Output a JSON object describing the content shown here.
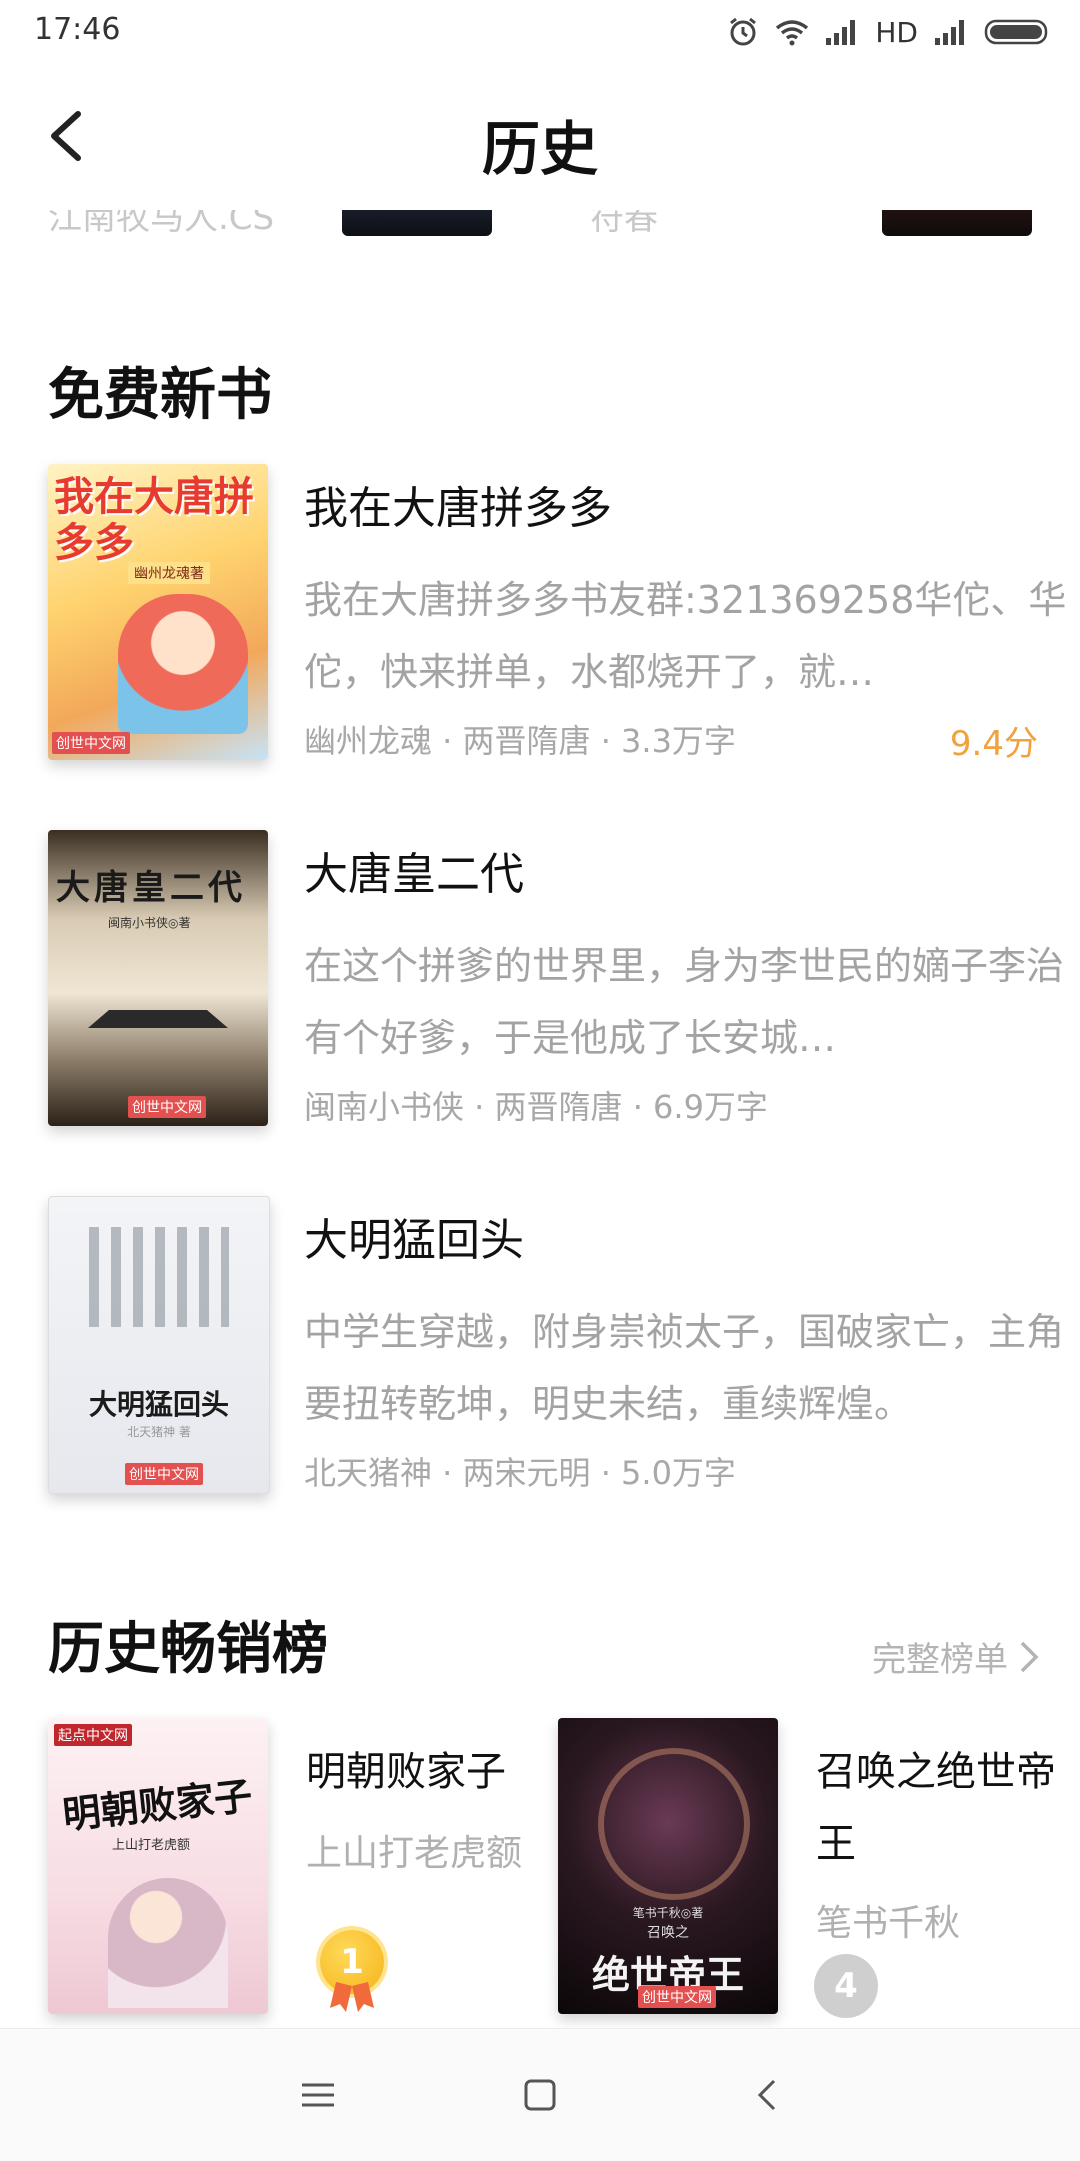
{
  "status_bar": {
    "time": "17:46",
    "network": "HD"
  },
  "header": {
    "title": "历史"
  },
  "prev_row": {
    "left_text": "江南牧马人.CS",
    "mid_text": "符春"
  },
  "free_new": {
    "title": "免费新书",
    "books": [
      {
        "title": "我在大唐拼多多",
        "desc": "我在大唐拼多多书友群:321369258华佗、华佗，快来拼单，水都烧开了，就…",
        "meta": "幽州龙魂 · 两晋隋唐 · 3.3万字",
        "score": "9.4分",
        "cover_text": "我在大唐拼多多",
        "cover_sub": "幽州龙魂著",
        "cover_logo": "创世中文网"
      },
      {
        "title": "大唐皇二代",
        "desc": "在这个拼爹的世界里，身为李世民的嫡子李治有个好爹，于是他成了长安城…",
        "meta": "闽南小书侠 · 两晋隋唐 · 6.9万字",
        "cover_text": "大唐皇二代",
        "cover_sub": "闽南小书侠◎著",
        "cover_logo": "创世中文网"
      },
      {
        "title": "大明猛回头",
        "desc": "中学生穿越，附身崇祯太子，国破家亡，主角要扭转乾坤，明史未结，重续辉煌。",
        "meta": "北天猪神 · 两宋元明 · 5.0万字",
        "cover_text": "大明猛回头",
        "cover_sub": "北天猪神 著",
        "cover_logo": "创世中文网"
      }
    ]
  },
  "bestseller": {
    "title": "历史畅销榜",
    "more_label": "完整榜单",
    "items": [
      {
        "title": "明朝败家子",
        "author": "上山打老虎额",
        "rank": "1",
        "cover_text": "明朝败家子",
        "cover_sub": "上山打老虎额",
        "cover_logo": "起点中文网"
      },
      {
        "title": "召唤之绝世帝王",
        "author": "笔书千秋",
        "rank": "4",
        "cover_text": "绝世帝王",
        "cover_sub": "笔书千秋◎著",
        "cover_top": "召唤之",
        "cover_logo": "创世中文网"
      }
    ]
  },
  "colors": {
    "accent_score": "#f0a23c",
    "gold_badge": "#f5b316",
    "gray_badge": "#cfcfcf"
  }
}
